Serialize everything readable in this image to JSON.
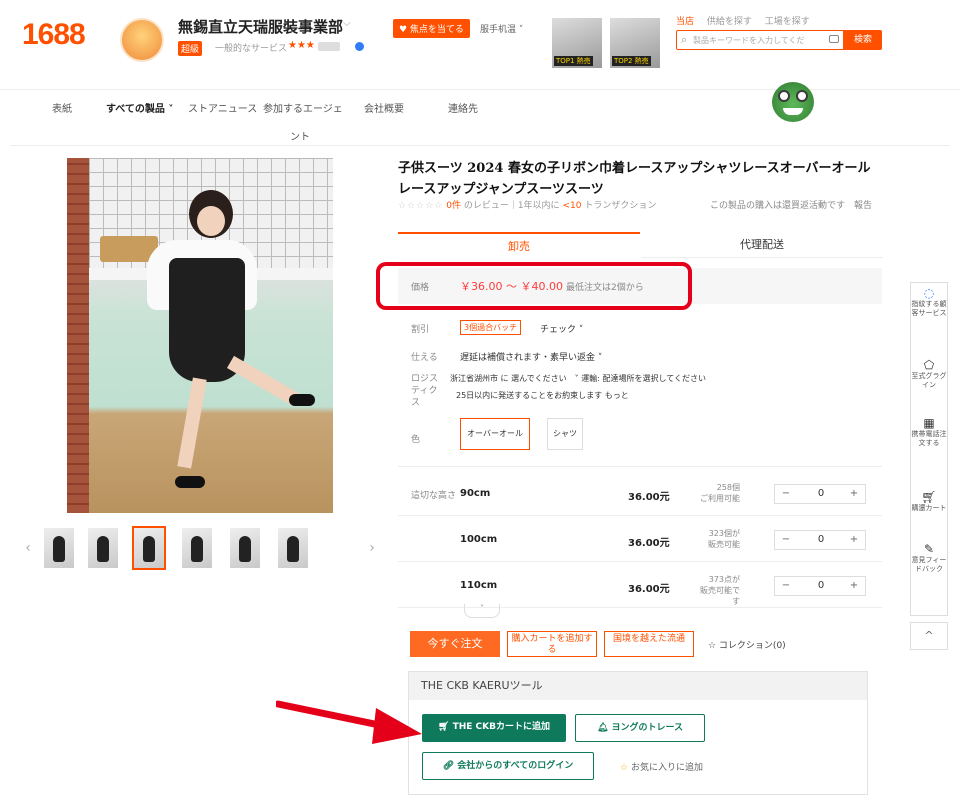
{
  "header": {
    "logo": "1688",
    "shop_name": "無錫直立天瑞服裝事業部",
    "shop_badge": "超級",
    "shop_sub": "一般的なサービス",
    "stars": "★★★",
    "follow_label": "♥ 焦点を当てる",
    "shop_menu": "服手机温 ˅",
    "top_thumb_tags": [
      "TOP1 熱売",
      "TOP2 熱売"
    ],
    "search_tabs": [
      "当店",
      "供給を探す",
      "工場を探す"
    ],
    "search_placeholder": "製品キーワードを入力してくだ",
    "search_button": "検索"
  },
  "nav": {
    "items": [
      "表紙",
      "すべての製品 ˅",
      "ストアニュース",
      "参加するエージェ",
      "会社概要",
      "連絡先"
    ],
    "wrap": "ント"
  },
  "product": {
    "title": "子供スーツ 2024 春女の子リボン巾着レースアップシャツレースオーバーオールレースアップジャンプスーツスーツ",
    "rating_stars": "☆☆☆☆☆",
    "review_count": "0件",
    "review_text": "のレビュー｜1年以内に",
    "transactions_count": "<10",
    "transactions_text": "トランザクション",
    "rating_right": "この製品の購入は還買返活動です　報告",
    "tabs": [
      "卸売",
      "代理配送"
    ],
    "price_label": "価格",
    "price": "￥36.00 ～ ￥40.00",
    "min_order": "最低注文は2個から",
    "discount_label": "割引",
    "discount_badge": "3個過合バッチ",
    "discount_check": "チェック ˅",
    "guarantee_label": "仕える",
    "guarantee_text": "遅延は補償されます・素早い返金 ˅",
    "logistics_label": "ロジスティクス",
    "logistics_from": "浙江省湖州市 に 選んでください　˅ 運輸: 配達場所を選択してください",
    "logistics_ship": "25日以内に発送することをお約束します もっと",
    "color_label": "色",
    "colors": [
      "オーバーオール",
      "シャツ"
    ],
    "size_label": "這切な高さ",
    "sizes": [
      {
        "name": "90cm",
        "price": "36.00元",
        "stock1": "258個",
        "stock2": "ご利用可能",
        "qty": "0"
      },
      {
        "name": "100cm",
        "price": "36.00元",
        "stock1": "323個が",
        "stock2": "販売可能",
        "qty": "0"
      },
      {
        "name": "110cm",
        "price": "36.00元",
        "stock1": "373点が",
        "stock2": "販売可能です",
        "qty": "0"
      }
    ],
    "expand": "˅",
    "order_button": "今すぐ注文",
    "cart_button": "購入カートを追加する",
    "cross_border_button": "国境を越えた流通",
    "collect": "☆ コレクション(0)"
  },
  "ckb": {
    "title": "THE CKB KAERUツール",
    "add_cart": "THE CKBカートに追加",
    "trace": "ヨングのトレース",
    "login": "会社からのすべてのログイン",
    "favorite": "お気に入りに追加"
  },
  "side": {
    "items": [
      "指紋する顧客サービス",
      "至式グラグイン",
      "携帯電話注文する",
      "購還カート",
      "意見フィードバック"
    ],
    "top": "^"
  },
  "colors": {
    "accent": "#ff5000",
    "ckb_green": "#0f7a5b",
    "highlight_red": "#e5001a"
  }
}
